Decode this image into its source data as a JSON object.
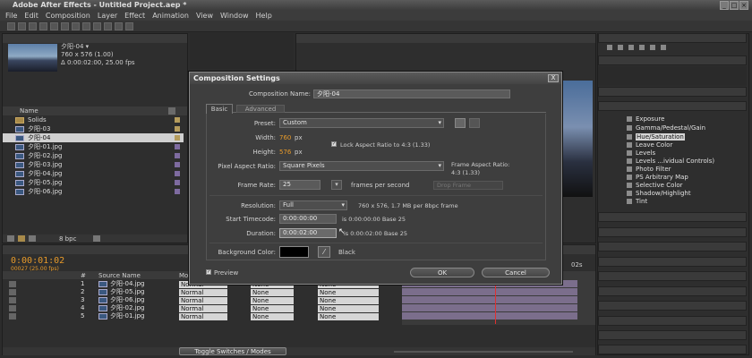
{
  "app": {
    "title": "Adobe After Effects - Untitled Project.aep *"
  },
  "menu": [
    "File",
    "Edit",
    "Composition",
    "Layer",
    "Effect",
    "Animation",
    "View",
    "Window",
    "Help"
  ],
  "project": {
    "comp_name": "夕阳-04 ▾",
    "comp_size": "760 x 576 (1.00)",
    "comp_duration": "Δ 0:00:02:00, 25.00 fps",
    "col_name": "Name",
    "items": [
      {
        "label": "Solids",
        "type": "folder"
      },
      {
        "label": "夕阳-03",
        "type": "comp"
      },
      {
        "label": "夕阳-04",
        "type": "comp",
        "selected": true
      },
      {
        "label": "夕阳-01.jpg",
        "type": "image"
      },
      {
        "label": "夕阳-02.jpg",
        "type": "image"
      },
      {
        "label": "夕阳-03.jpg",
        "type": "image"
      },
      {
        "label": "夕阳-04.jpg",
        "type": "image"
      },
      {
        "label": "夕阳-05.jpg",
        "type": "image"
      },
      {
        "label": "夕阳-06.jpg",
        "type": "image"
      }
    ],
    "bpc": "8 bpc"
  },
  "dialog": {
    "title": "Composition Settings",
    "close": "X",
    "name_label": "Composition Name:",
    "name_value": "夕阳-04",
    "tabs": [
      "Basic",
      "Advanced"
    ],
    "preset_label": "Preset:",
    "preset_value": "Custom",
    "width_label": "Width:",
    "width_value": "760",
    "height_label": "Height:",
    "height_value": "576",
    "px": "px",
    "lock_label": "Lock Aspect Ratio to 4:3 (1.33)",
    "par_label": "Pixel Aspect Ratio:",
    "par_value": "Square Pixels",
    "far_label": "Frame Aspect Ratio:",
    "far_value": "4:3 (1.33)",
    "fps_label": "Frame Rate:",
    "fps_value": "25",
    "fps_unit": "frames per second",
    "fps_extra": "Drop Frame",
    "res_label": "Resolution:",
    "res_value": "Full",
    "res_info": "760 x 576, 1.7 MB per 8bpc frame",
    "start_label": "Start Timecode:",
    "start_value": "0:00:00:00",
    "start_info": "is 0:00:00:00  Base 25",
    "dur_label": "Duration:",
    "dur_value": "0:00:02:00",
    "dur_info": "is 0:00:02:00  Base 25",
    "bg_label": "Background Color:",
    "bg_name": "Black",
    "preview_label": "Preview",
    "ok": "OK",
    "cancel": "Cancel"
  },
  "timeline": {
    "timecode": "0:00:01:02",
    "timecode_sub": "00027 (25.00 fps)",
    "col_num": "#",
    "col_source": "Source Name",
    "col_mode": "Mode",
    "layers": [
      {
        "num": "1",
        "name": "夕阳-04.jpg",
        "mode": "Normal",
        "trk": "None",
        "parent": "None"
      },
      {
        "num": "2",
        "name": "夕阳-05.jpg",
        "mode": "Normal",
        "trk": "None",
        "parent": "None"
      },
      {
        "num": "3",
        "name": "夕阳-06.jpg",
        "mode": "Normal",
        "trk": "None",
        "parent": "None"
      },
      {
        "num": "4",
        "name": "夕阳-02.jpg",
        "mode": "Normal",
        "trk": "None",
        "parent": "None"
      },
      {
        "num": "5",
        "name": "夕阳-01.jpg",
        "mode": "Normal",
        "trk": "None",
        "parent": "None"
      }
    ],
    "time_end": "02s",
    "toggle": "Toggle Switches / Modes"
  },
  "right_panel": {
    "effects": [
      "Exposure",
      "Gamma/Pedestal/Gain",
      "Hue/Saturation",
      "Leave Color",
      "Levels",
      "Levels ...ividual Controls)",
      "Photo Filter",
      "PS Arbitrary Map",
      "Selective Color",
      "Shadow/Highlight",
      "Tint"
    ],
    "selected_effect": 2
  },
  "colors": {
    "accent": "#e79a2a",
    "dialog_bg": "#3e3e3e",
    "selection": "#d0d0d0"
  }
}
